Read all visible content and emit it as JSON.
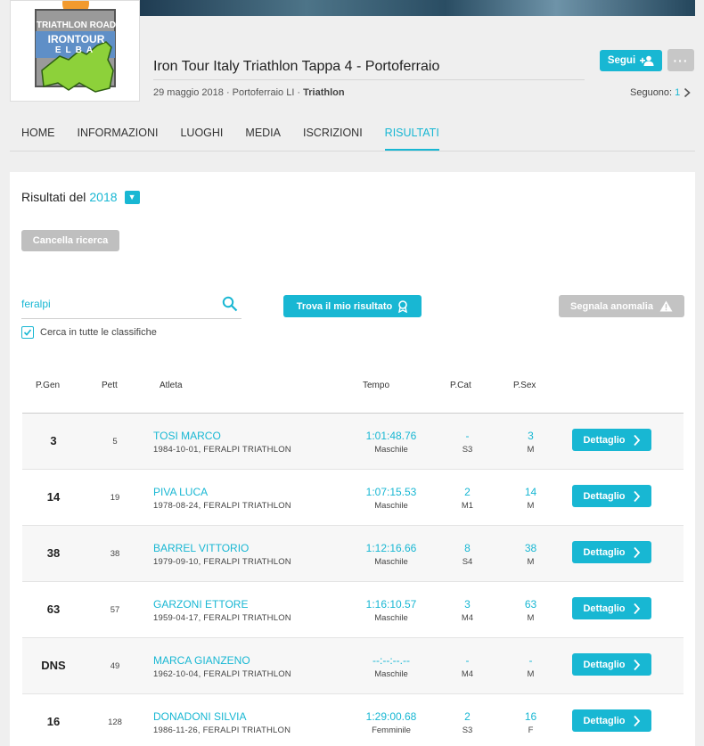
{
  "event": {
    "title": "Iron Tour Italy Triathlon Tappa 4 - Portoferraio",
    "meta": "29 maggio 2018 · Portoferraio LI · ",
    "sport": "Triathlon",
    "logo": {
      "line1": "TRIATHLON ROAD",
      "line2": "IRONTOUR",
      "line3": "ELBA"
    },
    "follow_label": "Segui",
    "more_label": "···",
    "followers_label": "Seguono:",
    "followers_count": "1"
  },
  "nav": [
    "HOME",
    "INFORMAZIONI",
    "LUOGHI",
    "MEDIA",
    "ISCRIZIONI",
    "RISULTATI"
  ],
  "results": {
    "year_prefix": "Risultati del",
    "year": "2018",
    "clear_label": "Cancella ricerca",
    "search_value": "feralpi",
    "checkbox_label": "Cerca in tutte le classifiche",
    "find_label": "Trova il mio risultato",
    "report_label": "Segnala anomalia"
  },
  "table": {
    "headers": {
      "gen": "P.Gen",
      "pett": "Pett",
      "atleta": "Atleta",
      "tempo": "Tempo",
      "cat": "P.Cat",
      "sex": "P.Sex"
    },
    "detail_label": "Dettaglio",
    "rows": [
      {
        "gen": "3",
        "pett": "5",
        "name": "TOSI MARCO",
        "sub": "1984-10-01, FERALPI TRIATHLON",
        "time": "1:01:48.76",
        "category": "Maschile",
        "pcat": "-",
        "cat": "S3",
        "psex": "3",
        "sex": "M"
      },
      {
        "gen": "14",
        "pett": "19",
        "name": "PIVA LUCA",
        "sub": "1978-08-24, FERALPI TRIATHLON",
        "time": "1:07:15.53",
        "category": "Maschile",
        "pcat": "2",
        "cat": "M1",
        "psex": "14",
        "sex": "M"
      },
      {
        "gen": "38",
        "pett": "38",
        "name": "BARREL VITTORIO",
        "sub": "1979-09-10, FERALPI TRIATHLON",
        "time": "1:12:16.66",
        "category": "Maschile",
        "pcat": "8",
        "cat": "S4",
        "psex": "38",
        "sex": "M"
      },
      {
        "gen": "63",
        "pett": "57",
        "name": "GARZONI ETTORE",
        "sub": "1959-04-17, FERALPI TRIATHLON",
        "time": "1:16:10.57",
        "category": "Maschile",
        "pcat": "3",
        "cat": "M4",
        "psex": "63",
        "sex": "M"
      },
      {
        "gen": "DNS",
        "pett": "49",
        "name": "MARCA GIANZENO",
        "sub": "1962-10-04, FERALPI TRIATHLON",
        "time": "--:--:--.--",
        "category": "Maschile",
        "pcat": "-",
        "cat": "M4",
        "psex": "-",
        "sex": "M"
      },
      {
        "gen": "16",
        "pett": "128",
        "name": "DONADONI SILVIA",
        "sub": "1986-11-26, FERALPI TRIATHLON",
        "time": "1:29:00.68",
        "category": "Femminile",
        "pcat": "2",
        "cat": "S3",
        "psex": "16",
        "sex": "F"
      }
    ]
  },
  "colors": {
    "accent": "#18b7d3",
    "muted_button": "#c3c3c3",
    "background": "#efefef"
  }
}
